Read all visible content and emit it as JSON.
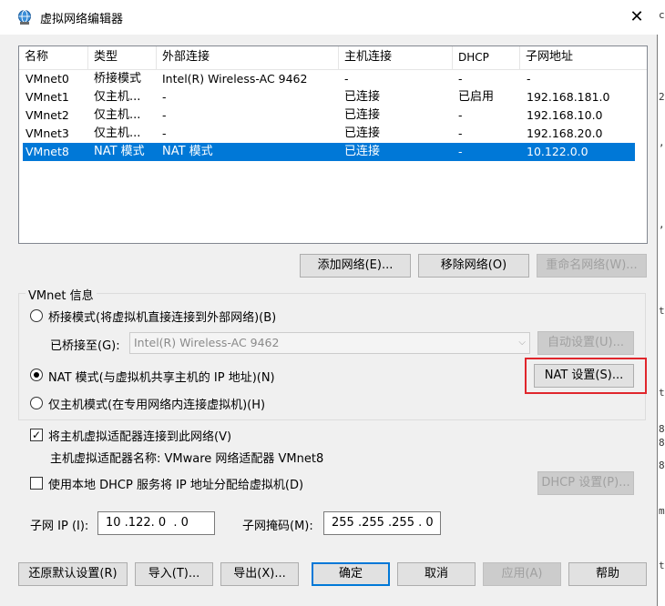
{
  "window": {
    "title": "虚拟网络编辑器",
    "close_label": "✕"
  },
  "table": {
    "columns": [
      "名称",
      "类型",
      "外部连接",
      "主机连接",
      "DHCP",
      "子网地址"
    ],
    "rows": [
      {
        "name": "VMnet0",
        "type": "桥接模式",
        "external": "Intel(R) Wireless-AC 9462",
        "host": "-",
        "dhcp": "-",
        "subnet": "-",
        "selected": false
      },
      {
        "name": "VMnet1",
        "type": "仅主机...",
        "external": "-",
        "host": "已连接",
        "dhcp": "已启用",
        "subnet": "192.168.181.0",
        "selected": false
      },
      {
        "name": "VMnet2",
        "type": "仅主机...",
        "external": "-",
        "host": "已连接",
        "dhcp": "-",
        "subnet": "192.168.10.0",
        "selected": false
      },
      {
        "name": "VMnet3",
        "type": "仅主机...",
        "external": "-",
        "host": "已连接",
        "dhcp": "-",
        "subnet": "192.168.20.0",
        "selected": false
      },
      {
        "name": "VMnet8",
        "type": "NAT 模式",
        "external": "NAT 模式",
        "host": "已连接",
        "dhcp": "-",
        "subnet": "10.122.0.0",
        "selected": true
      }
    ]
  },
  "table_buttons": {
    "add": "添加网络(E)...",
    "remove": "移除网络(O)",
    "rename": "重命名网络(W)..."
  },
  "vmnet_info": {
    "title": "VMnet 信息",
    "bridged_label": "桥接模式(将虚拟机直接连接到外部网络)(B)",
    "bridged_to_label": "已桥接至(G):",
    "bridged_to_value": "Intel(R) Wireless-AC 9462",
    "auto_settings": "自动设置(U)...",
    "nat_label": "NAT 模式(与虚拟机共享主机的 IP 地址)(N)",
    "nat_settings": "NAT 设置(S)...",
    "hostonly_label": "仅主机模式(在专用网络内连接虚拟机)(H)",
    "selected_mode": "nat"
  },
  "host_adapter": {
    "connect_label": "将主机虚拟适配器连接到此网络(V)",
    "connect_checked": true,
    "adapter_name_label": "主机虚拟适配器名称: VMware 网络适配器 VMnet8"
  },
  "dhcp": {
    "label": "使用本地 DHCP 服务将 IP 地址分配给虚拟机(D)",
    "checked": false,
    "settings": "DHCP 设置(P)..."
  },
  "subnet": {
    "ip_label": "子网 IP (I):",
    "ip_value": "10 .122. 0  . 0",
    "mask_label": "子网掩码(M):",
    "mask_value": "255 .255 .255 . 0"
  },
  "footer": {
    "restore": "还原默认设置(R)",
    "import": "导入(T)...",
    "export": "导出(X)...",
    "ok": "确定",
    "cancel": "取消",
    "apply": "应用(A)",
    "help": "帮助"
  },
  "colors": {
    "selection": "#0078d7",
    "highlight_border": "#e0262c"
  },
  "icons": {
    "title": "network-globe-icon",
    "close": "close-icon",
    "combo_arrow": "chevron-down-icon",
    "check": "checkmark-icon"
  }
}
